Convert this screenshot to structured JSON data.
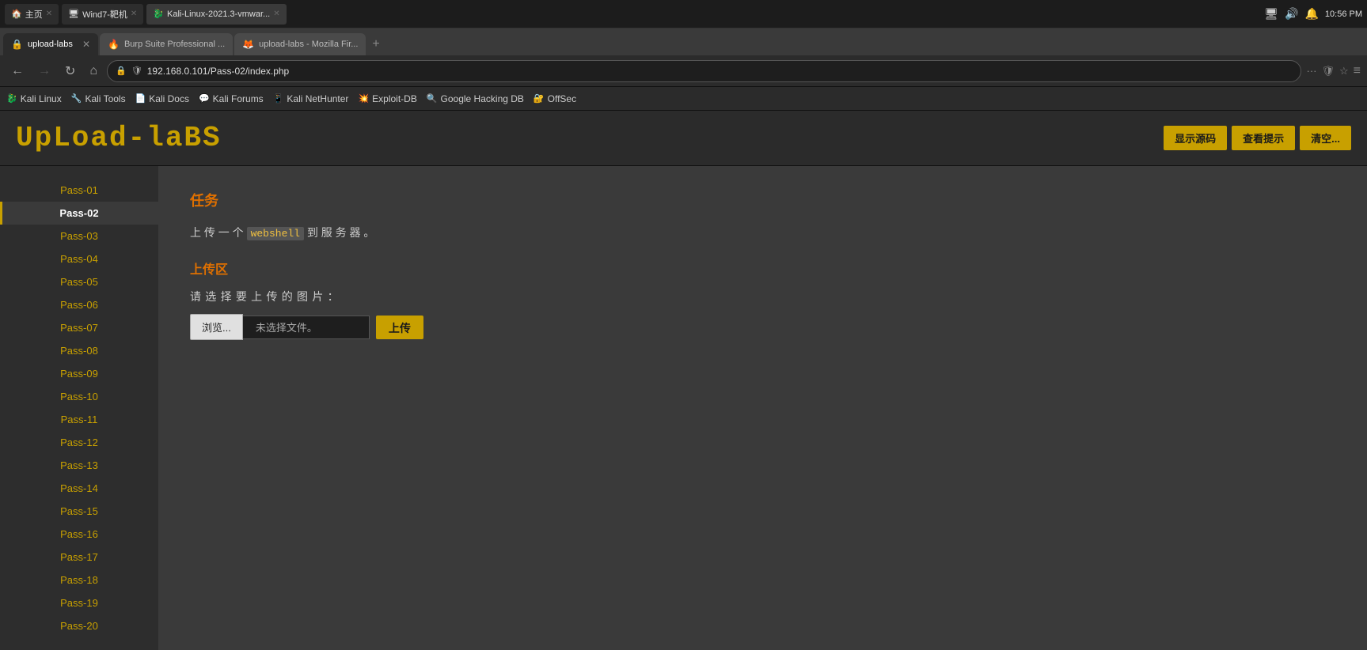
{
  "os": {
    "taskbar": {
      "items": [
        {
          "label": "主页",
          "active": false,
          "icon": "🏠"
        },
        {
          "label": "Wind7-靶机",
          "active": false,
          "icon": "🖥"
        },
        {
          "label": "Kali-Linux-2021.3-vmwar...",
          "active": true,
          "icon": "🐉"
        }
      ],
      "clock": "10:56 PM"
    }
  },
  "browser": {
    "tabs": [
      {
        "label": "upload-labs",
        "active": true,
        "favicon": "🔒"
      },
      {
        "label": "Burp Suite Professional ...",
        "active": false,
        "favicon": "🔥"
      },
      {
        "label": "upload-labs - Mozilla Fir...",
        "active": false,
        "favicon": "🦊"
      }
    ],
    "url": "192.168.0.101/Pass-02/index.php",
    "bookmarks": [
      {
        "label": "Kali Linux",
        "icon": "🐉"
      },
      {
        "label": "Kali Tools",
        "icon": "🔧"
      },
      {
        "label": "Kali Docs",
        "icon": "📄"
      },
      {
        "label": "Kali Forums",
        "icon": "💬"
      },
      {
        "label": "Kali NetHunter",
        "icon": "📱"
      },
      {
        "label": "Exploit-DB",
        "icon": "💥"
      },
      {
        "label": "Google Hacking DB",
        "icon": "🔍"
      },
      {
        "label": "OffSec",
        "icon": "🔐"
      }
    ]
  },
  "site": {
    "logo": "UpLoad-laBS",
    "header_buttons": [
      {
        "label": "显示源码"
      },
      {
        "label": "查看提示"
      },
      {
        "label": "清空..."
      }
    ]
  },
  "sidebar": {
    "items": [
      "Pass-01",
      "Pass-02",
      "Pass-03",
      "Pass-04",
      "Pass-05",
      "Pass-06",
      "Pass-07",
      "Pass-08",
      "Pass-09",
      "Pass-10",
      "Pass-11",
      "Pass-12",
      "Pass-13",
      "Pass-14",
      "Pass-15",
      "Pass-16",
      "Pass-17",
      "Pass-18",
      "Pass-19",
      "Pass-20"
    ],
    "active_index": 1
  },
  "content": {
    "task_label": "任务",
    "task_description_prefix": "上 传 一 个",
    "task_code": "webshell",
    "task_description_suffix": "到 服 务 器 。",
    "upload_zone_label": "上传区",
    "upload_file_label": "请 选 择 要 上 传 的 图 片 ：",
    "browse_button": "浏览...",
    "file_placeholder": "未选择文件。",
    "upload_button": "上传"
  }
}
